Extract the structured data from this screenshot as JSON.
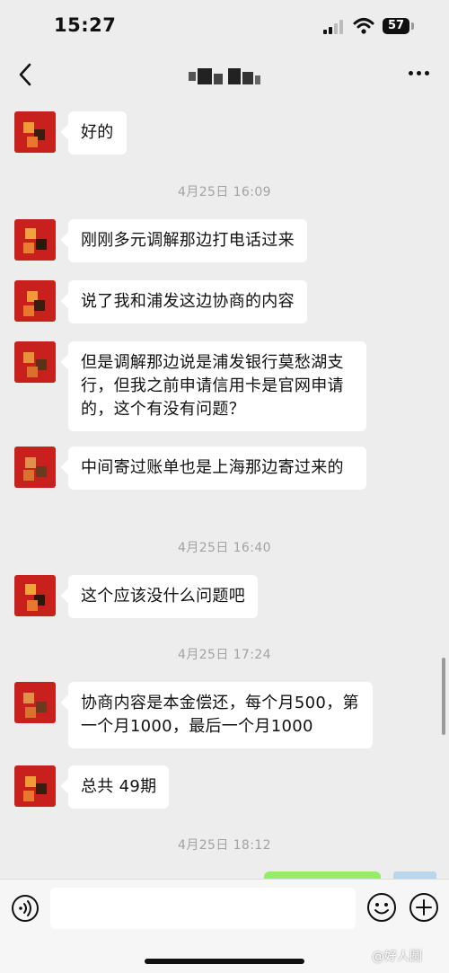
{
  "status_bar": {
    "time": "15:27",
    "battery": "57"
  },
  "nav": {
    "back_icon": "chevron-left-icon",
    "more_icon": "more-dots-icon"
  },
  "theme": {
    "background": "#ededed",
    "bubble_incoming": "#ffffff",
    "bubble_outgoing": "#95ec69",
    "avatar_red": "#c8201c",
    "timestamp_gray": "#a3a3a3"
  },
  "messages": [
    {
      "type": "incoming",
      "text": "好的"
    },
    {
      "type": "time",
      "text": "4月25日 16:09"
    },
    {
      "type": "incoming",
      "text": "刚刚多元调解那边打电话过来"
    },
    {
      "type": "incoming",
      "text": "说了我和浦发这边协商的内容"
    },
    {
      "type": "incoming",
      "text": "但是调解那边说是浦发银行莫愁湖支行，但我之前申请信用卡是官网申请的，这个有没有问题？"
    },
    {
      "type": "incoming",
      "text": "中间寄过账单也是上海那边寄过来的"
    },
    {
      "type": "time",
      "text": "4月25日 16:40"
    },
    {
      "type": "incoming",
      "text": "这个应该没什么问题吧"
    },
    {
      "type": "time",
      "text": "4月25日 17:24"
    },
    {
      "type": "incoming",
      "text": "协商内容是本金偿还，每个月500，第一个月1000，最后一个月1000"
    },
    {
      "type": "incoming",
      "text": "总共 49期"
    },
    {
      "type": "time",
      "text": "4月25日 18:12"
    }
  ],
  "input_bar": {
    "placeholder": "",
    "voice_icon": "voice-icon",
    "emoji_icon": "emoji-icon",
    "plus_icon": "plus-icon"
  },
  "watermark": "@好人圆"
}
